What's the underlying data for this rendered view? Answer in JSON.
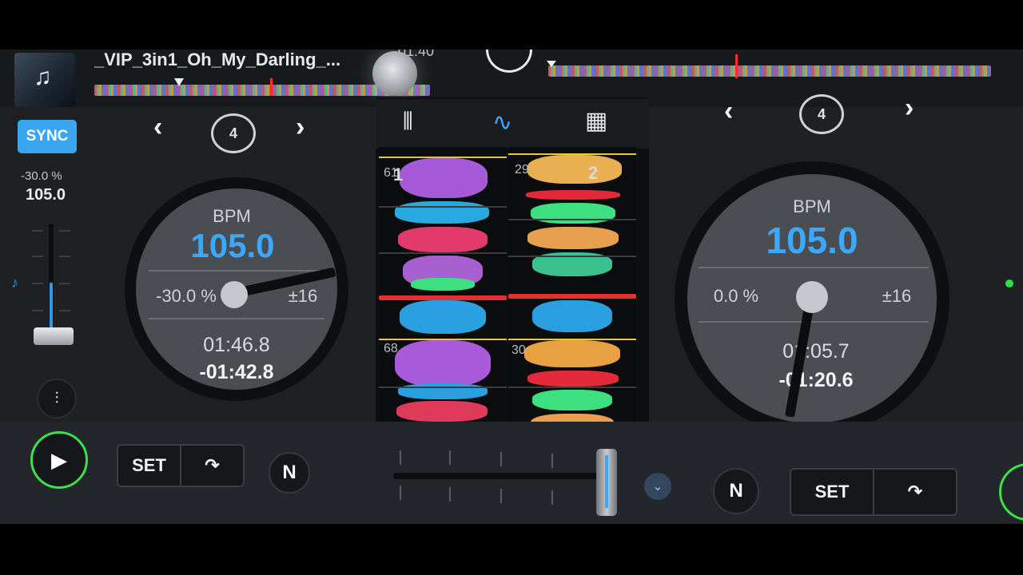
{
  "deck1": {
    "track_title": "_VIP_3in1_Oh_My_Darling_...",
    "top_time": "-01:40",
    "sync_label": "SYNC",
    "pitch_percent": "-30.0 %",
    "pitch_bpm": "105.0",
    "prev_label": "‹",
    "next_label": "›",
    "loop_count": "4",
    "bpm_label": "BPM",
    "bpm": "105.0",
    "pitch_display": "-30.0 %",
    "range": "±16",
    "elapsed": "01:46.8",
    "remaining": "-01:42.8",
    "set_label": "SET",
    "n_label": "N"
  },
  "deck2": {
    "prev_label": "‹",
    "next_label": "›",
    "loop_count": "4",
    "bpm_label": "BPM",
    "bpm": "105.0",
    "pitch_display": "0.0 %",
    "range": "±16",
    "elapsed": "01:05.7",
    "remaining": "-01:20.6",
    "set_label": "SET",
    "n_label": "N"
  },
  "center": {
    "beat_labels_left": [
      "61",
      "68"
    ],
    "beat_labels_right": [
      "29",
      "30"
    ],
    "deck_badge_left": "1",
    "deck_badge_right": "2"
  },
  "colors": {
    "accent_blue": "#3da8ff",
    "sync_blue": "#3aa6f0",
    "play_green": "#3ce04a"
  },
  "icons": [
    "music-note-icon",
    "eq-sliders-icon",
    "mixer-view-icon",
    "waveform-view-icon",
    "pads-grid-icon",
    "loop-icon",
    "play-icon",
    "cue-jump-icon",
    "chevron-down-icon"
  ]
}
